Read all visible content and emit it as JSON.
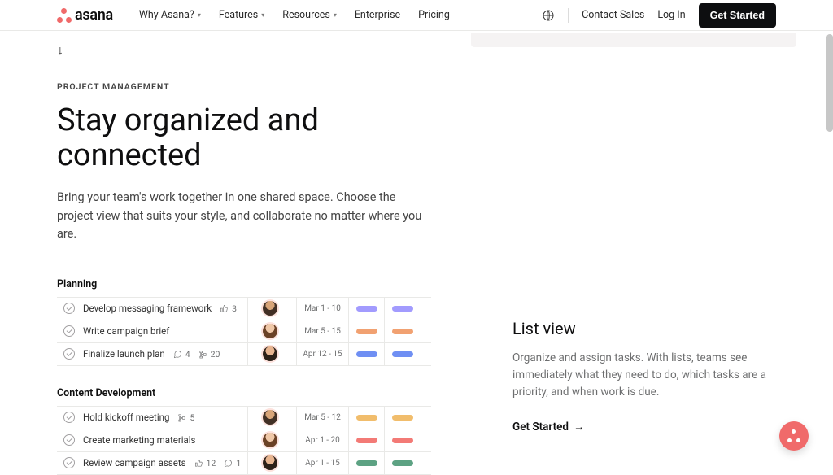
{
  "nav": {
    "brand": "asana",
    "links": [
      {
        "label": "Why Asana?",
        "dropdown": true
      },
      {
        "label": "Features",
        "dropdown": true
      },
      {
        "label": "Resources",
        "dropdown": true
      },
      {
        "label": "Enterprise",
        "dropdown": false
      },
      {
        "label": "Pricing",
        "dropdown": false
      }
    ],
    "contact": "Contact Sales",
    "login": "Log In",
    "cta": "Get Started"
  },
  "hero": {
    "eyebrow": "PROJECT MANAGEMENT",
    "headline": "Stay organized and connected",
    "subcopy": "Bring your team's work together in one shared space. Choose the project view that suits your style, and collaborate no matter where you are."
  },
  "groups": [
    {
      "name": "Planning",
      "tasks": [
        {
          "title": "Develop messaging framework",
          "likes": "3",
          "date": "Mar 1 - 10",
          "color": "purple",
          "avatar": "av1"
        },
        {
          "title": "Write campaign brief",
          "date": "Mar 5 - 15",
          "color": "orange",
          "avatar": "av2"
        },
        {
          "title": "Finalize launch plan",
          "comments": "4",
          "subtasks": "20",
          "date": "Apr 12 - 15",
          "color": "blue",
          "avatar": "av3"
        }
      ]
    },
    {
      "name": "Content Development",
      "tasks": [
        {
          "title": "Hold kickoff meeting",
          "subtasks": "5",
          "date": "Mar 5 - 12",
          "color": "yellow",
          "avatar": "av1"
        },
        {
          "title": "Create marketing materials",
          "date": "Apr 1 - 20",
          "color": "red",
          "avatar": "av2"
        },
        {
          "title": "Review campaign assets",
          "likes": "12",
          "comments": "1",
          "date": "Apr 1 - 15",
          "color": "green",
          "avatar": "av3"
        }
      ]
    }
  ],
  "side": {
    "title": "List view",
    "copy": "Organize and assign tasks. With lists, teams see immediately what they need to do, which tasks are a priority, and when work is due.",
    "cta": "Get Started"
  }
}
